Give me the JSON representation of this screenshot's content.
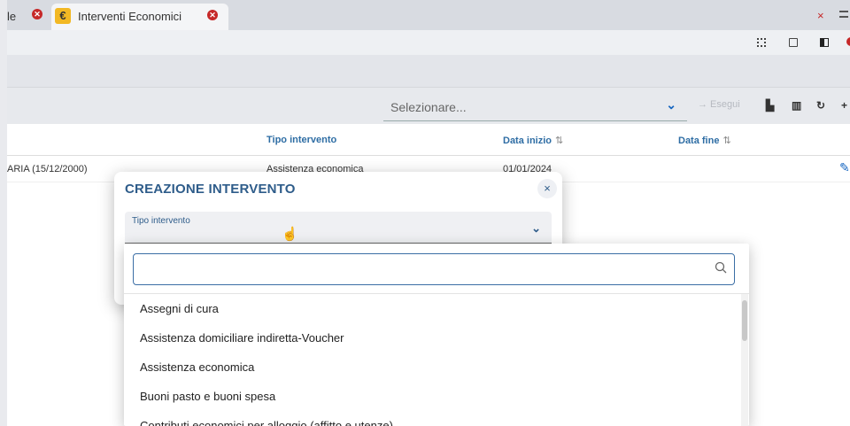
{
  "tabs": {
    "prev_label": "le",
    "active_label": "Interventi Economici",
    "active_icon": "euro-icon"
  },
  "window_controls": {
    "close_symbol": "×"
  },
  "filter": {
    "select_placeholder": "Selezionare...",
    "exec_label": "→ Esegui"
  },
  "table": {
    "columns": [
      "Tipo intervento",
      "Data inizio",
      "Data fine"
    ],
    "rows": [
      {
        "name": "ARIA (15/12/2000)",
        "type": "Assistenza economica",
        "start": "01/01/2024",
        "end": ""
      }
    ]
  },
  "dialog": {
    "title": "CREAZIONE INTERVENTO",
    "close_symbol": "×",
    "field_label": "Tipo intervento"
  },
  "dropdown": {
    "search_value": "",
    "options": [
      "Assegni di cura",
      "Assistenza domiciliare indiretta-Voucher",
      "Assistenza economica",
      "Buoni pasto e buoni spesa",
      "Contributi economici per alloggio (affitto e utenze)"
    ]
  },
  "colors": {
    "accent": "#2e5c8a",
    "link_blue": "#1565c0",
    "danger": "#c62828",
    "euro_badge": "#f2b824"
  }
}
